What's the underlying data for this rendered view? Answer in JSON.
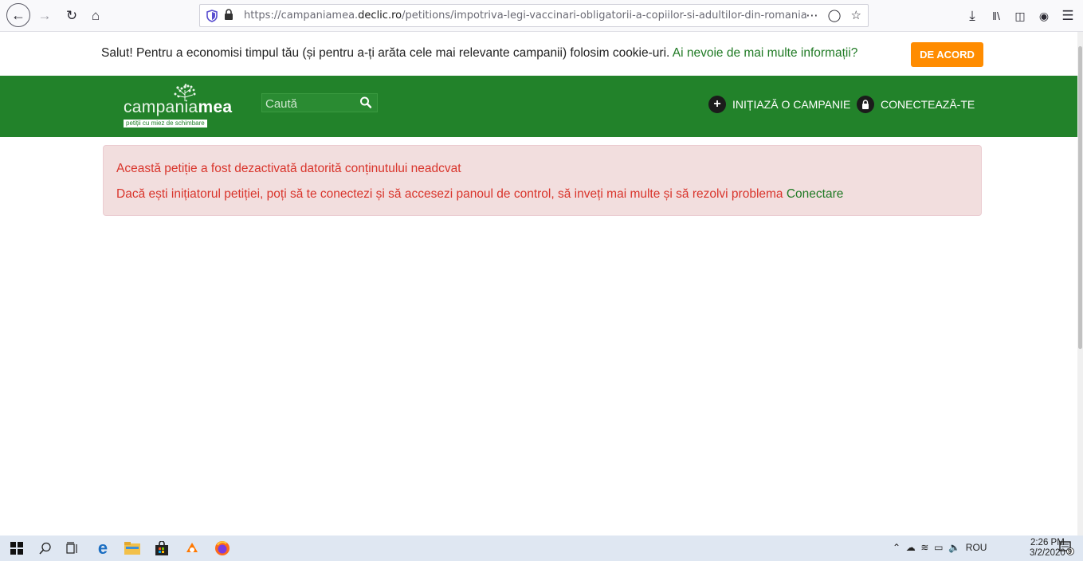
{
  "browser": {
    "url_prefix": "https://campaniamea.",
    "url_domain": "declic.ro",
    "url_path": "/petitions/impotriva-legi-vaccinari-obligatorii-a-copiilor-si-adultilor-din-romania"
  },
  "cookie_bar": {
    "message": "Salut! Pentru a economisi timpul tău (și pentru a-ți arăta cele mai relevante campanii) folosim cookie-uri.",
    "link": "Ai nevoie de mai multe informații?",
    "accept_label": "DE ACORD"
  },
  "header": {
    "logo_light": "campania",
    "logo_bold": "mea",
    "logo_tagline": "petiții cu miez de schimbare",
    "search_placeholder": "Caută",
    "start_campaign": "INIȚIAZĂ O CAMPANIE",
    "login": "CONECTEAZĂ-TE"
  },
  "alert": {
    "line1": "Această petiție a fost dezactivată datorită conținutului neadcvat",
    "line2": "Dacă ești inițiatorul petiției, poți să te conectezi și să accesezi panoul de control, să inveți mai multe și să rezolvi problema",
    "link": "Conectare"
  },
  "taskbar": {
    "language": "ROU",
    "time": "2:26 PM",
    "date": "3/2/2020",
    "notification_count": "9"
  },
  "colors": {
    "brand_green": "#22822a",
    "accent_orange": "#ff8c00",
    "alert_text": "#d9342b",
    "alert_bg": "#f2dede"
  }
}
